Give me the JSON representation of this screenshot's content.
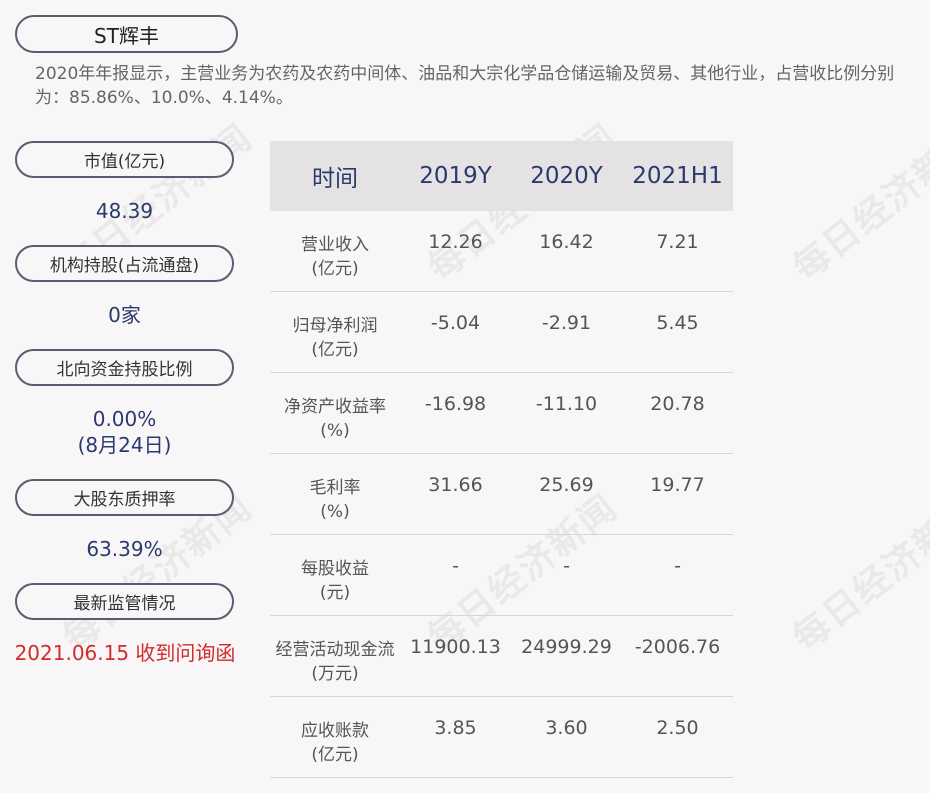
{
  "title": "ST辉丰",
  "intro": "2020年年报显示，主营业务为农药及农药中间体、油品和大宗化学品仓储运输及贸易、其他行业，占营收比例分别为：85.86%、10.0%、4.14%。",
  "sidebar": {
    "market_value": {
      "label": "市值(亿元)",
      "value": "48.39"
    },
    "institution": {
      "label": "机构持股(占流通盘)",
      "value": "0家"
    },
    "northbound": {
      "label": "北向资金持股比例",
      "value": "0.00%",
      "date": "(8月24日)"
    },
    "pledge": {
      "label": "大股东质押率",
      "value": "63.39%"
    },
    "regulation": {
      "label": "最新监管情况",
      "value": "2021.06.15 收到问询函"
    }
  },
  "table": {
    "headers": [
      "时间",
      "2019Y",
      "2020Y",
      "2021H1"
    ],
    "rows": [
      {
        "label1": "营业收入",
        "label2": "(亿元)",
        "values": [
          "12.26",
          "16.42",
          "7.21"
        ]
      },
      {
        "label1": "归母净利润",
        "label2": "(亿元)",
        "values": [
          "-5.04",
          "-2.91",
          "5.45"
        ]
      },
      {
        "label1": "净资产收益率",
        "label2": "(%)",
        "values": [
          "-16.98",
          "-11.10",
          "20.78"
        ]
      },
      {
        "label1": "毛利率",
        "label2": "(%)",
        "values": [
          "31.66",
          "25.69",
          "19.77"
        ]
      },
      {
        "label1": "每股收益",
        "label2": "(元)",
        "values": [
          "-",
          "-",
          "-"
        ]
      },
      {
        "label1": "经营活动现金流",
        "label2": "(万元)",
        "values": [
          "11900.13",
          "24999.29",
          "-2006.76"
        ]
      },
      {
        "label1": "应收账款",
        "label2": "(亿元)",
        "values": [
          "3.85",
          "3.60",
          "2.50"
        ]
      }
    ]
  },
  "watermark": "每日经济新闻"
}
